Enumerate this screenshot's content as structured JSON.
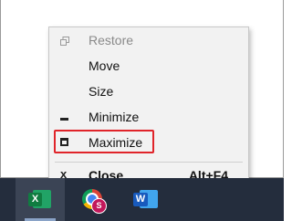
{
  "context_menu": {
    "items": [
      {
        "label": "Restore",
        "icon": "restore-icon",
        "disabled": true
      },
      {
        "label": "Move",
        "icon": null,
        "disabled": false
      },
      {
        "label": "Size",
        "icon": null,
        "disabled": false
      },
      {
        "label": "Minimize",
        "icon": "minimize-icon",
        "disabled": false
      },
      {
        "label": "Maximize",
        "icon": "maximize-icon",
        "disabled": false,
        "highlighted": true
      },
      {
        "label": "Close",
        "icon": "close-icon",
        "disabled": false,
        "bold": true,
        "shortcut": "Alt+F4"
      }
    ],
    "close_icon_glyph": "x",
    "highlight_color": "#e0242a"
  },
  "taskbar": {
    "apps": [
      {
        "name": "excel",
        "icon": "excel-icon",
        "letter": "X",
        "active": true
      },
      {
        "name": "chrome",
        "icon": "chrome-icon",
        "badge_letter": "S",
        "active": false
      },
      {
        "name": "word",
        "icon": "word-icon",
        "letter": "W",
        "active": false
      }
    ]
  }
}
